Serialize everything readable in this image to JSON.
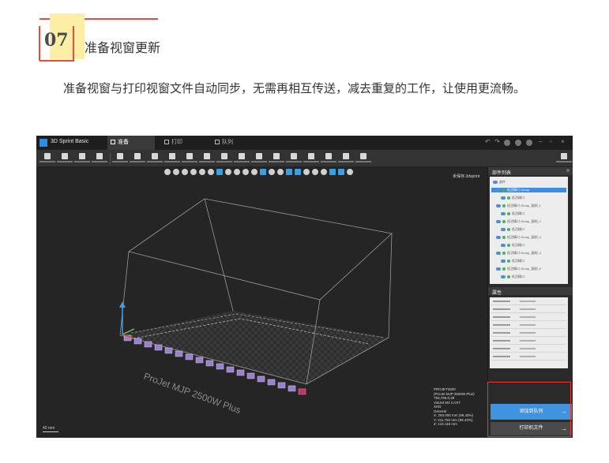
{
  "section": {
    "number": "07",
    "title": "准备视窗更新",
    "paragraph": "准备视窗与打印视窗文件自动同步，无需再相互传送，减去重复的工作，让使用更流畅。"
  },
  "app": {
    "name": "3D Sprint Basic",
    "tabs": [
      {
        "label": "准备",
        "active": true
      },
      {
        "label": "打印",
        "active": false
      },
      {
        "label": "队列",
        "active": false
      }
    ],
    "file_label": "未保存.3dsprint",
    "printer_text": "ProJet MJP 2500W Plus",
    "scale_label": "40 mm",
    "stats": [
      "PROJET2500",
      "(ProJet MJP 2500W Plus)",
      "793,786.0,39",
      "VisiJet M2 CAST",
      "XHD",
      "General",
      "X: 293.000 mm (99.40%)",
      "Y: 211.782 mm (99.40%)",
      "Z: 144.118 mm"
    ],
    "panel": {
      "parts_title": "部件列表",
      "properties_title": "属性",
      "tree_items": [
        {
          "label": "部件",
          "indent": 0,
          "selected": false
        },
        {
          "label": "低活精口 Group",
          "indent": 1,
          "selected": true
        },
        {
          "label": "低活精口",
          "indent": 2,
          "selected": false
        },
        {
          "label": "低活精口 Group_复制_1",
          "indent": 1,
          "selected": false
        },
        {
          "label": "低活精口",
          "indent": 2,
          "selected": false
        },
        {
          "label": "低活精口 Group_复制_2",
          "indent": 1,
          "selected": false
        },
        {
          "label": "低活精口",
          "indent": 2,
          "selected": false
        },
        {
          "label": "低活精口 Group_复制_3",
          "indent": 1,
          "selected": false
        },
        {
          "label": "低活精口",
          "indent": 2,
          "selected": false
        },
        {
          "label": "低活精口 Group_复制_4",
          "indent": 1,
          "selected": false
        },
        {
          "label": "低活精口",
          "indent": 2,
          "selected": false
        },
        {
          "label": "低活精口 Group_复制_5",
          "indent": 1,
          "selected": false
        },
        {
          "label": "低活精口",
          "indent": 2,
          "selected": false
        }
      ],
      "add_to_print_button": "添加到队列",
      "open_print_file_button": "打印机文件"
    }
  },
  "colors": {
    "accent_red": "#e94b3c",
    "highlight_yellow": "#fcefa5",
    "app_blue": "#3f93df"
  }
}
